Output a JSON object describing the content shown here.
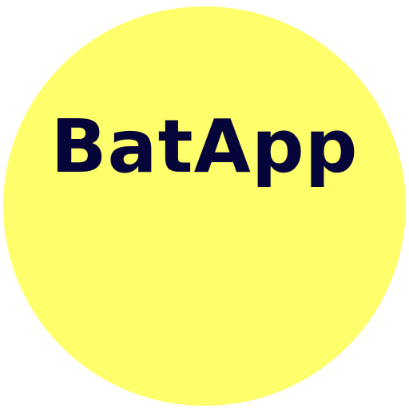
{
  "app": {
    "name": "BatApp"
  },
  "colors": {
    "background": "#ffffff",
    "circle": "#ffff6b",
    "text": "#05053a"
  }
}
